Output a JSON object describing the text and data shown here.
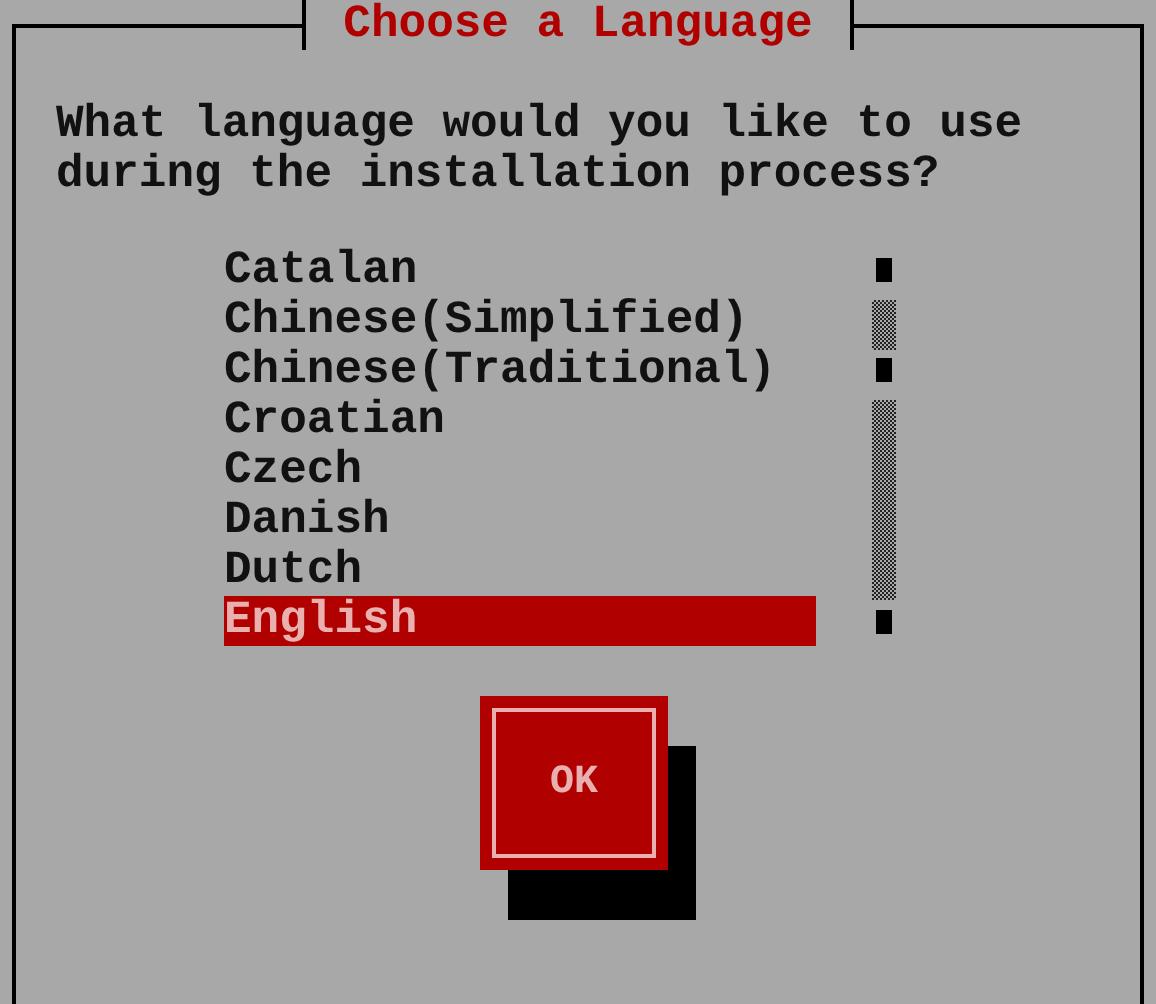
{
  "dialog": {
    "title": "Choose a Language",
    "prompt": "What language would you like to use during the installation process?"
  },
  "languages": [
    {
      "label": "Catalan",
      "selected": false
    },
    {
      "label": "Chinese(Simplified)",
      "selected": false
    },
    {
      "label": "Chinese(Traditional)",
      "selected": false
    },
    {
      "label": "Croatian",
      "selected": false
    },
    {
      "label": "Czech",
      "selected": false
    },
    {
      "label": "Danish",
      "selected": false
    },
    {
      "label": "Dutch",
      "selected": false
    },
    {
      "label": "English",
      "selected": true
    }
  ],
  "buttons": [
    {
      "label": "OK"
    }
  ]
}
